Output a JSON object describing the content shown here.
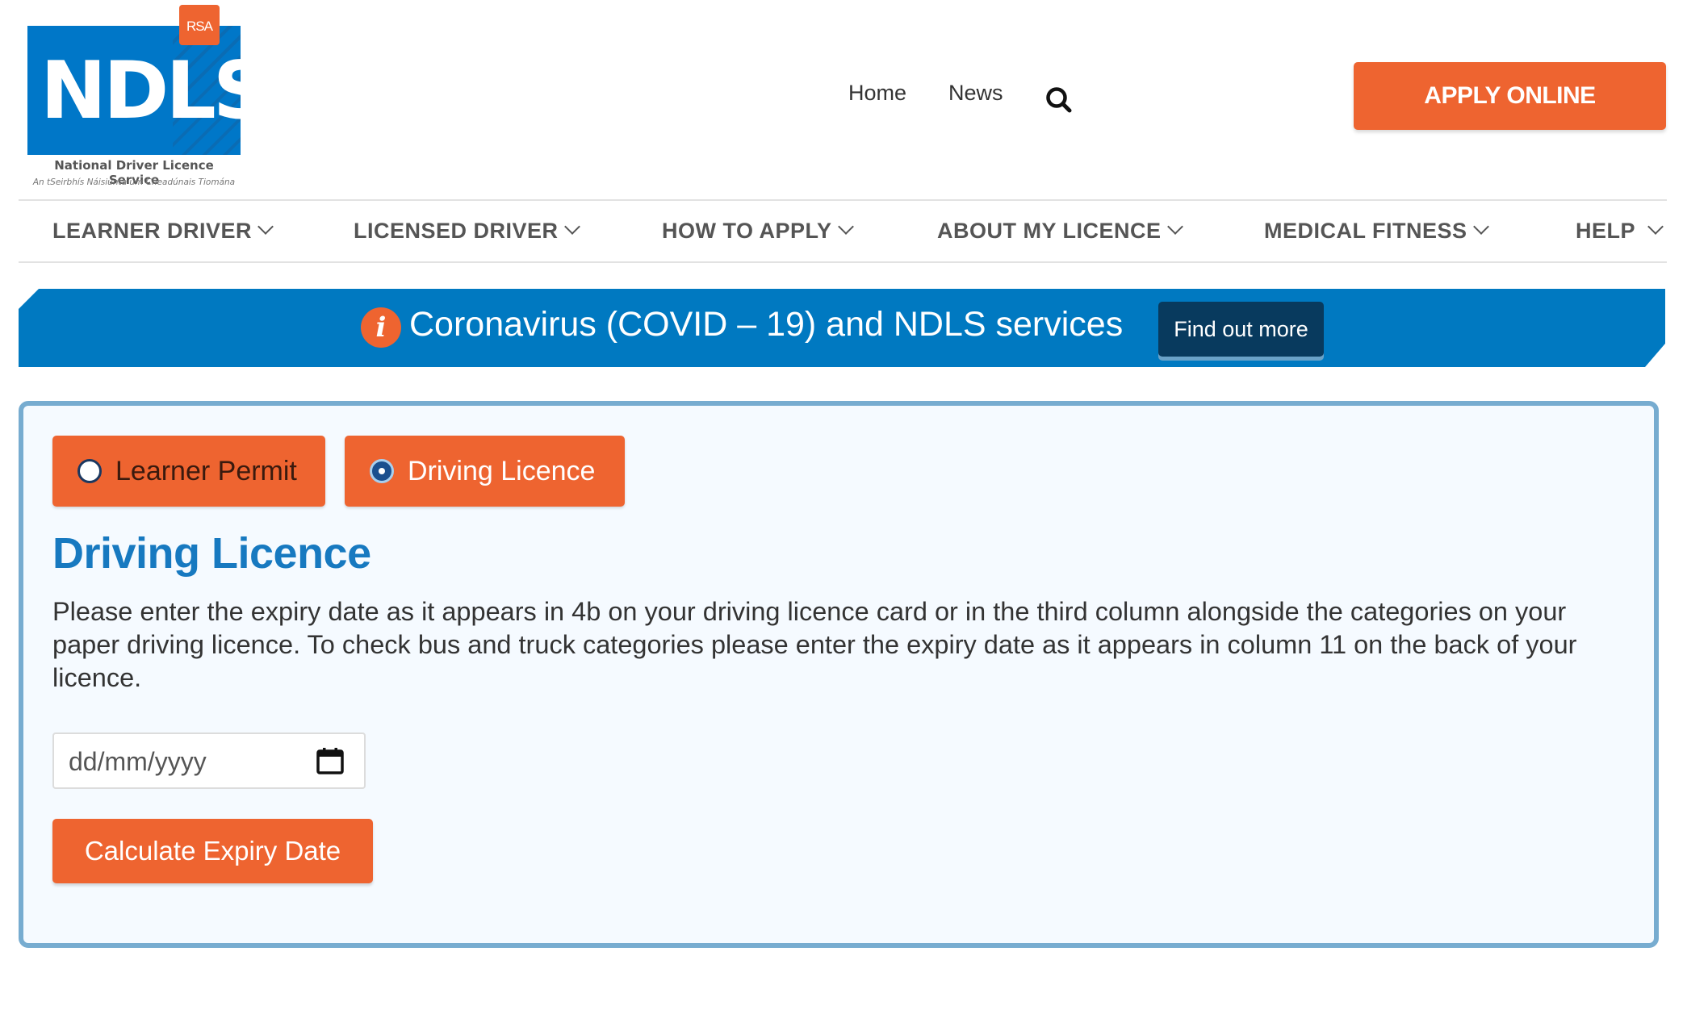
{
  "logo": {
    "main": "NDLS",
    "badge": "RSA",
    "subtitle": "National Driver Licence Service",
    "subtitle_irish": "An tSeirbhís Náisiúnta um Cheadúnais Tiomána"
  },
  "header": {
    "links": [
      {
        "label": "Home"
      },
      {
        "label": "News"
      }
    ],
    "search_icon": "search-icon",
    "apply_label": "APPLY ONLINE"
  },
  "nav": {
    "items": [
      {
        "label": "LEARNER DRIVER"
      },
      {
        "label": "LICENSED DRIVER"
      },
      {
        "label": "HOW TO APPLY"
      },
      {
        "label": "ABOUT MY LICENCE"
      },
      {
        "label": "MEDICAL FITNESS"
      },
      {
        "label": "HELP"
      }
    ]
  },
  "banner": {
    "icon": "info-icon",
    "icon_glyph": "i",
    "text": "Coronavirus (COVID – 19) and NDLS services",
    "button_label": "Find out more"
  },
  "form": {
    "options": [
      {
        "label": "Learner Permit",
        "selected": false
      },
      {
        "label": "Driving Licence",
        "selected": true
      }
    ],
    "title": "Driving Licence",
    "description": "Please enter the expiry date as it appears in 4b on your driving licence card or in the third column alongside the categories on your paper driving licence. To check bus and truck categories please enter the expiry date as it appears in column 11 on the back of your licence.",
    "date_placeholder": "dd/mm/yyyy",
    "date_value": "",
    "submit_label": "Calculate Expiry Date"
  },
  "colors": {
    "brand_blue": "#0079c1",
    "brand_orange": "#ee6430",
    "dark_navy": "#083a5e",
    "box_border": "#77acd0",
    "title_blue": "#1779c0"
  }
}
